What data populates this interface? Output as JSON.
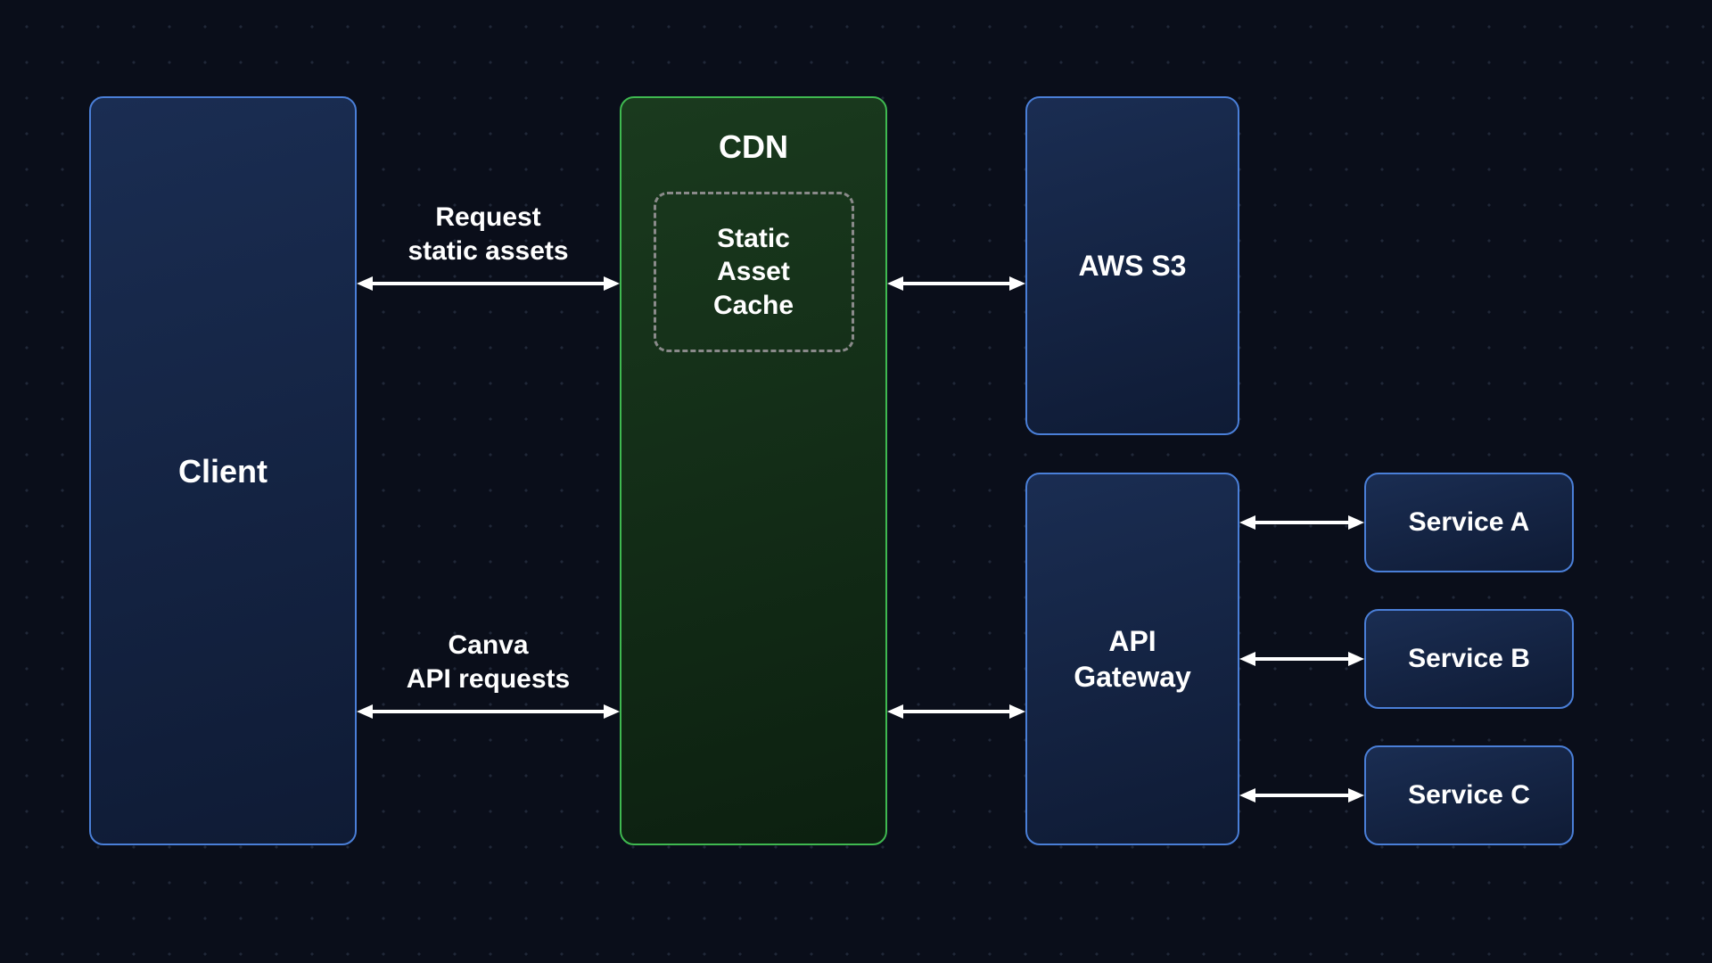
{
  "nodes": {
    "client": {
      "label": "Client"
    },
    "cdn": {
      "label": "CDN"
    },
    "static_cache": {
      "label_l1": "Static",
      "label_l2": "Asset",
      "label_l3": "Cache"
    },
    "aws_s3": {
      "label": "AWS S3"
    },
    "api_gateway": {
      "label_l1": "API",
      "label_l2": "Gateway"
    },
    "service_a": {
      "label": "Service A"
    },
    "service_b": {
      "label": "Service B"
    },
    "service_c": {
      "label": "Service C"
    }
  },
  "connectors": {
    "client_cdn_static": {
      "label_l1": "Request",
      "label_l2": "static assets"
    },
    "client_cdn_api": {
      "label_l1": "Canva",
      "label_l2": "API requests"
    }
  },
  "colors": {
    "blue_border": "#4a7fd8",
    "green_border": "#3fb950",
    "bg": "#0a0e1a"
  }
}
